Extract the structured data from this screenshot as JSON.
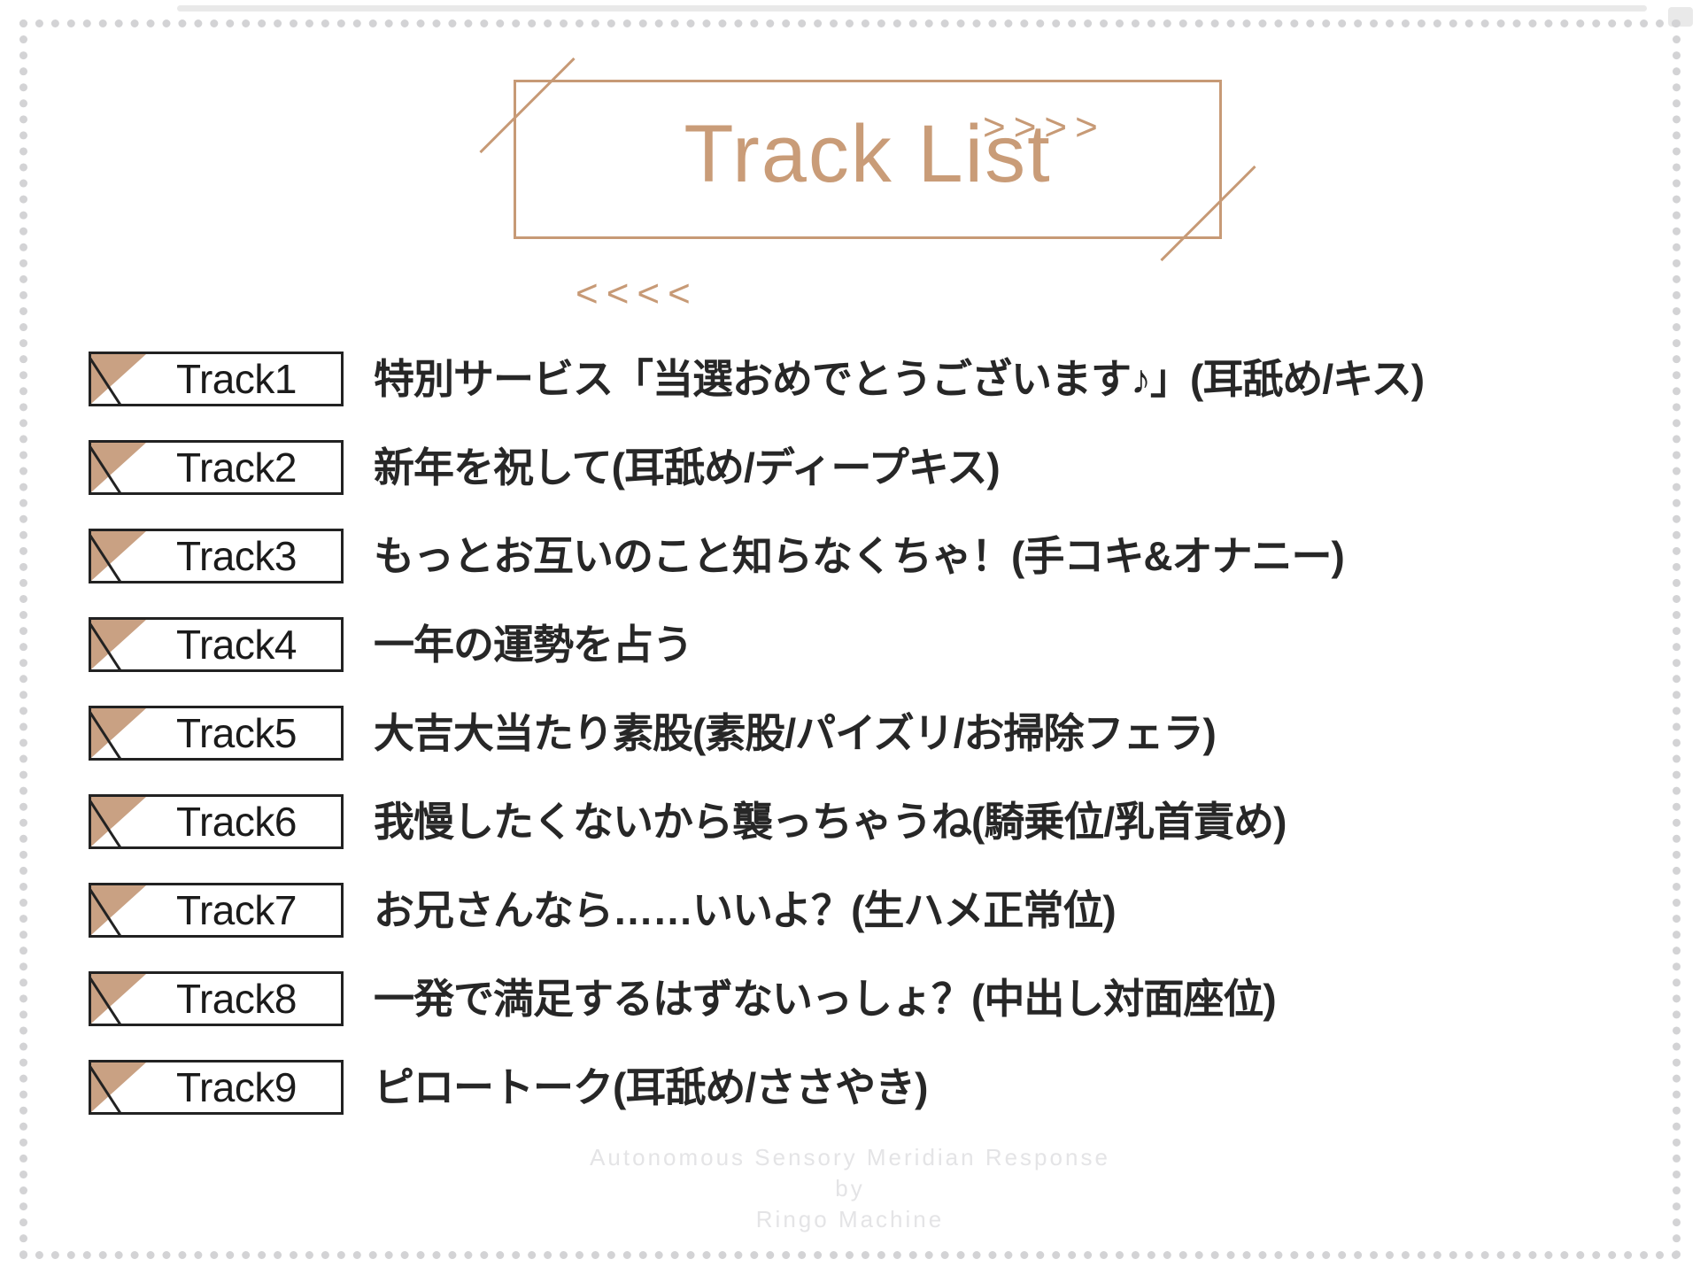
{
  "header": {
    "title": "Track List",
    "chevrons_right": ">>>>",
    "chevrons_left": "<<<<",
    "accent_color": "#c99c78"
  },
  "tracks": [
    {
      "badge": "Track1",
      "title": "特別サービス「当選おめでとうございます♪」(耳舐め/キス)"
    },
    {
      "badge": "Track2",
      "title": "新年を祝して(耳舐め/ディープキス)"
    },
    {
      "badge": "Track3",
      "title": "もっとお互いのこと知らなくちゃ！(手コキ&オナニー)"
    },
    {
      "badge": "Track4",
      "title": "一年の運勢を占う"
    },
    {
      "badge": "Track5",
      "title": "大吉大当たり素股(素股/パイズリ/お掃除フェラ)"
    },
    {
      "badge": "Track6",
      "title": "我慢したくないから襲っちゃうね(騎乗位/乳首責め)"
    },
    {
      "badge": "Track7",
      "title": "お兄さんなら……いいよ？(生ハメ正常位)"
    },
    {
      "badge": "Track8",
      "title": "一発で満足するはずないっしょ？(中出し対面座位)"
    },
    {
      "badge": "Track9",
      "title": "ピロートーク(耳舐め/ささやき)"
    }
  ],
  "footer": {
    "line1": "Autonomous Sensory Meridian Response",
    "line2": "by",
    "line3": "Ringo Machine"
  }
}
